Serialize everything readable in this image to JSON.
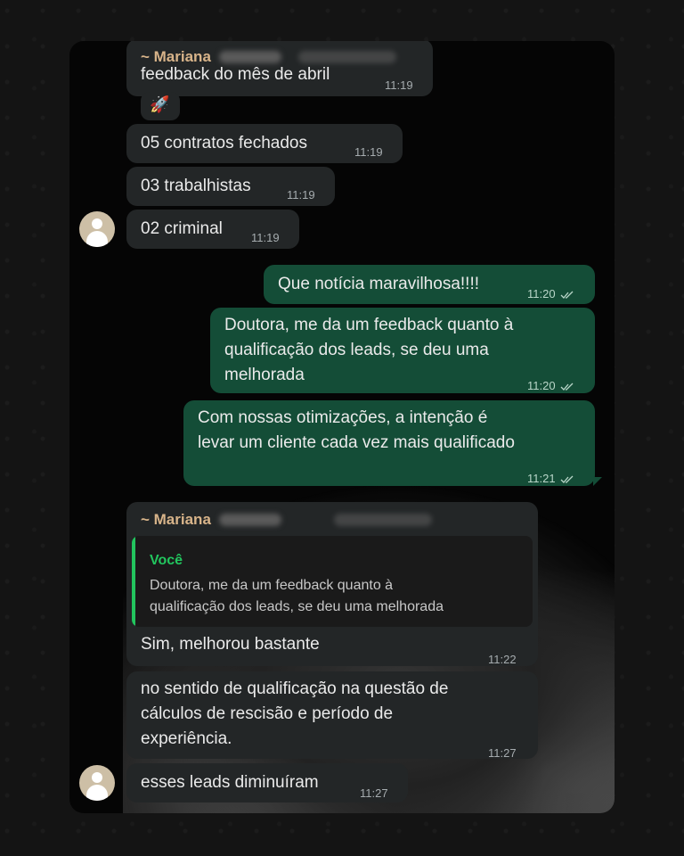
{
  "messages": {
    "m1": {
      "sender": "~ Mariana",
      "text": "feedback do mês de abril",
      "time": "11:19"
    },
    "rocket": {
      "emoji": "🚀"
    },
    "m2": {
      "text": "05 contratos fechados",
      "time": "11:19"
    },
    "m3": {
      "text": "03 trabalhistas",
      "time": "11:19"
    },
    "m4": {
      "text": "02 criminal",
      "time": "11:19"
    },
    "o1": {
      "text": "Que notícia maravilhosa!!!!",
      "time": "11:20"
    },
    "o2": {
      "line1": "Doutora, me da um feedback quanto à",
      "line2": "qualificação dos leads, se deu uma",
      "line3": "melhorada",
      "time": "11:20"
    },
    "o3": {
      "line1": "Com nossas otimizações, a intenção é",
      "line2": "levar um cliente cada vez mais qualificado",
      "time": "11:21"
    },
    "m5": {
      "sender": "~ Mariana",
      "quote_name": "Você",
      "quote_line1": "Doutora, me da um feedback quanto à",
      "quote_line2": "qualificação dos leads, se deu uma melhorada",
      "text": "Sim, melhorou bastante",
      "time": "11:22"
    },
    "m6": {
      "line1": "no sentido de qualificação na questão de",
      "line2": "cálculos de rescisão e período de",
      "line3": "experiência.",
      "time": "11:27"
    },
    "m7": {
      "text": "esses leads diminuíram",
      "time": "11:27"
    }
  },
  "colors": {
    "incoming": "#232627",
    "outgoing": "#144d37",
    "quote_accent": "#22c55e",
    "sender_name": "#d8b48a"
  },
  "icons": {
    "read_receipt": "double-check-icon",
    "avatar": "default-avatar-icon"
  }
}
